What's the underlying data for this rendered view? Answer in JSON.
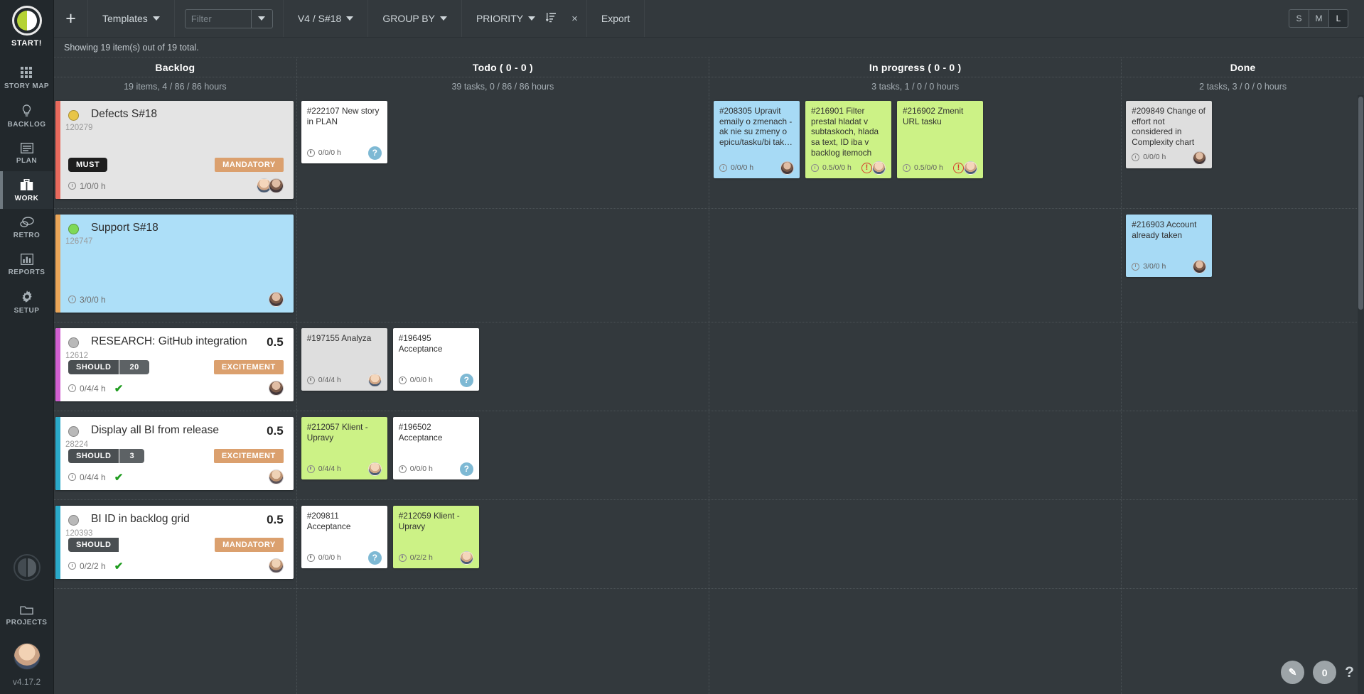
{
  "sidebar": {
    "brand_label": "START!",
    "items": [
      {
        "label": "STORY MAP",
        "icon": "grid-icon",
        "active": false
      },
      {
        "label": "BACKLOG",
        "icon": "lightbulb-icon",
        "active": false
      },
      {
        "label": "PLAN",
        "icon": "list-icon",
        "active": false
      },
      {
        "label": "WORK",
        "icon": "briefcase-icon",
        "active": true
      },
      {
        "label": "RETRO",
        "icon": "chat-icon",
        "active": false
      },
      {
        "label": "REPORTS",
        "icon": "bar-chart-icon",
        "active": false
      },
      {
        "label": "SETUP",
        "icon": "gear-icon",
        "active": false
      }
    ],
    "projects_label": "PROJECTS",
    "version": "v4.17.2"
  },
  "toolbar": {
    "add_label": "+",
    "templates_label": "Templates",
    "filter_placeholder": "Filter",
    "filter_value": "",
    "sprint_label": "V4 / S#18",
    "group_by_label": "GROUP BY",
    "priority_label": "PRIORITY",
    "sort_icon": "sort-icon",
    "clear_label": "×",
    "export_label": "Export",
    "sizes": [
      {
        "label": "S",
        "active": false
      },
      {
        "label": "M",
        "active": false
      },
      {
        "label": "L",
        "active": true
      }
    ]
  },
  "status_bar": {
    "showing": "Showing 19 item(s) out of 19 total."
  },
  "columns": [
    {
      "title": "Backlog",
      "sub": "19 items, 4 / 86 / 86 hours"
    },
    {
      "title": "Todo  (  0  -  0  )",
      "sub": "39 tasks, 0 / 86 / 86 hours"
    },
    {
      "title": "In progress   (  0  -  0  )",
      "sub": "3 tasks, 1 / 0 / 0 hours"
    },
    {
      "title": "Done",
      "sub": "2 tasks, 3 / 0 / 0 hours"
    }
  ],
  "colors": {
    "accent_red": "#e8695c",
    "accent_orange": "#eaa558",
    "accent_magenta": "#d05fd0",
    "accent_cyan": "#2aa9c9",
    "accent_teal": "#2aa9c9",
    "badge_tag": "#dba06e",
    "card_green": "#ccf286",
    "card_blue": "#a7daf5",
    "warning_red": "#d63b2a",
    "check_green": "#1e9c1e"
  },
  "rows": [
    {
      "backlog": {
        "title": "Defects S#18",
        "id": "120279",
        "points": "",
        "accent": "#e8695c",
        "bg": "gray",
        "dot": "#e8c547",
        "badges": [
          {
            "type": "must",
            "label": "MUST"
          }
        ],
        "tag": "MANDATORY",
        "hours": "1/0/0 h",
        "check": false,
        "avatars": [
          "a1",
          "a2"
        ]
      },
      "todo": [
        {
          "text": "#222107 New story in PLAN",
          "color": "white",
          "hours": "0/0/0 h",
          "warn": false,
          "avatars": [
            "q"
          ]
        }
      ],
      "inprogress": [
        {
          "text": "#208305 Upravit emaily o zmenach - ak nie su zmeny o epicu/tasku/bi tak…",
          "color": "blue",
          "hours": "0/0/0 h",
          "warn": false,
          "avatars": [
            "a2"
          ]
        },
        {
          "text": "#216901 Filter prestal hladat v subtaskoch, hlada sa text, ID iba v backlog itemoch",
          "color": "green",
          "hours": "0.5/0/0 h",
          "warn": true,
          "avatars": [
            "a1"
          ]
        },
        {
          "text": "#216902 Zmenit URL tasku",
          "color": "green",
          "hours": "0.5/0/0 h",
          "warn": true,
          "avatars": [
            "a1"
          ]
        }
      ],
      "done": [
        {
          "text": "#209849 Change of effort not considered in Complexity chart",
          "color": "gray",
          "hours": "0/0/0 h",
          "warn": false,
          "avatars": [
            "a2"
          ]
        }
      ]
    },
    {
      "backlog": {
        "title": "Support S#18",
        "id": "126747",
        "points": "",
        "accent": "#eaa558",
        "bg": "blue",
        "dot": "#7ed957",
        "badges": [],
        "tag": "",
        "hours": "3/0/0 h",
        "check": false,
        "avatars": [
          "a2"
        ]
      },
      "todo": [],
      "inprogress": [],
      "done": [
        {
          "text": "#216903 Account already taken",
          "color": "blue",
          "hours": "3/0/0 h",
          "warn": false,
          "avatars": [
            "a2"
          ]
        }
      ]
    },
    {
      "backlog": {
        "title": "RESEARCH: GitHub integration",
        "id": "12612",
        "points": "0.5",
        "accent": "#d05fd0",
        "bg": "white",
        "dot": "#b9b9b9",
        "badges": [
          {
            "type": "should",
            "label": "SHOULD"
          },
          {
            "type": "num",
            "label": "20"
          }
        ],
        "tag": "EXCITEMENT",
        "hours": "0/4/4 h",
        "check": true,
        "avatars": [
          "a2"
        ]
      },
      "todo": [
        {
          "text": "#197155 Analyza",
          "color": "gray",
          "hours": "0/4/4 h",
          "warn": false,
          "avatars": [
            "a1"
          ]
        },
        {
          "text": "#196495 Acceptance",
          "color": "white",
          "hours": "0/0/0 h",
          "warn": false,
          "avatars": [
            "q"
          ]
        }
      ],
      "inprogress": [],
      "done": []
    },
    {
      "backlog": {
        "title": "Display all BI from release",
        "id": "28224",
        "points": "0.5",
        "accent": "#2aa9c9",
        "bg": "white",
        "dot": "#b9b9b9",
        "badges": [
          {
            "type": "should",
            "label": "SHOULD"
          },
          {
            "type": "num",
            "label": "3"
          }
        ],
        "tag": "EXCITEMENT",
        "hours": "0/4/4 h",
        "check": true,
        "avatars": [
          "a3"
        ]
      },
      "todo": [
        {
          "text": "#212057 Klient - Upravy",
          "color": "green",
          "hours": "0/4/4 h",
          "warn": false,
          "avatars": [
            "a1"
          ]
        },
        {
          "text": "#196502 Acceptance",
          "color": "white",
          "hours": "0/0/0 h",
          "warn": false,
          "avatars": [
            "q"
          ]
        }
      ],
      "inprogress": [],
      "done": []
    },
    {
      "backlog": {
        "title": "BI ID in backlog grid",
        "id": "120393",
        "points": "0.5",
        "accent": "#2aa9c9",
        "bg": "white",
        "dot": "#b9b9b9",
        "badges": [
          {
            "type": "should",
            "label": "SHOULD"
          }
        ],
        "tag": "MANDATORY",
        "hours": "0/2/2 h",
        "check": true,
        "avatars": [
          "a3"
        ]
      },
      "todo": [
        {
          "text": "#209811 Acceptance",
          "color": "white",
          "hours": "0/0/0 h",
          "warn": false,
          "avatars": [
            "q"
          ]
        },
        {
          "text": "#212059 Klient - Upravy",
          "color": "green",
          "hours": "0/2/2 h",
          "warn": false,
          "avatars": [
            "a1"
          ]
        }
      ],
      "inprogress": [],
      "done": []
    }
  ],
  "fabs": [
    {
      "name": "edit-fab",
      "label": "✎"
    },
    {
      "name": "count-fab",
      "label": "0"
    },
    {
      "name": "help-fab",
      "label": "?"
    }
  ]
}
